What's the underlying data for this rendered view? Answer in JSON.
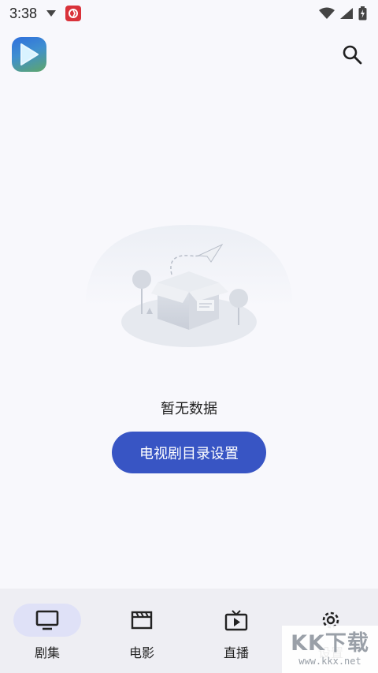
{
  "status_bar": {
    "time": "3:38",
    "icons": [
      "download-arrow-icon",
      "app-notification-icon",
      "wifi-icon",
      "cell-signal-icon",
      "battery-charging-icon"
    ]
  },
  "header": {
    "logo_icon": "play-icon",
    "search_icon": "search-icon"
  },
  "empty_state": {
    "illustration": "empty-box-illustration",
    "message": "暂无数据",
    "action_label": "电视剧目录设置"
  },
  "bottom_nav": {
    "items": [
      {
        "label": "剧集",
        "icon": "tv-icon",
        "active": true
      },
      {
        "label": "电影",
        "icon": "clapperboard-icon",
        "active": false
      },
      {
        "label": "直播",
        "icon": "live-tv-icon",
        "active": false
      },
      {
        "label": "设置",
        "icon": "gear-icon",
        "active": false
      }
    ]
  },
  "watermark": {
    "logo": "KK下载",
    "url": "www.kkx.net"
  },
  "colors": {
    "accent": "#3855c4",
    "background": "#f8f8fc",
    "nav_background": "#eeeef3",
    "nav_active_pill": "#dfe1f7"
  }
}
